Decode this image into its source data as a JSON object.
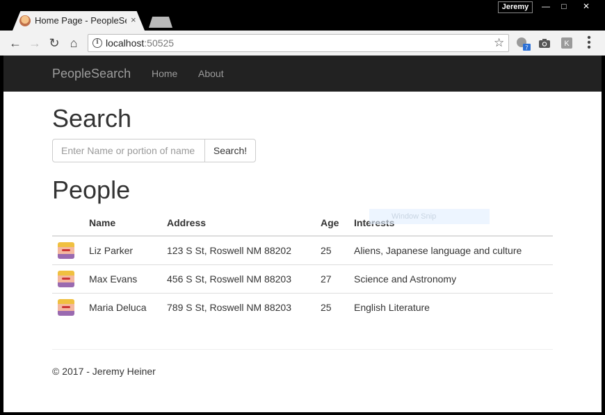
{
  "browser": {
    "tab_title": "Home Page - PeopleSearch",
    "tab_close": "×",
    "profile_name": "Jeremy",
    "url_host": "localhost",
    "url_port": ":50525",
    "ext_badge": "7",
    "ext_k": "K"
  },
  "navbar": {
    "brand": "PeopleSearch",
    "links": [
      "Home",
      "About"
    ]
  },
  "search": {
    "heading": "Search",
    "placeholder": "Enter Name or portion of name",
    "button_label": "Search!"
  },
  "people": {
    "heading": "People",
    "columns": [
      "",
      "Name",
      "Address",
      "Age",
      "Interests"
    ],
    "rows": [
      {
        "name": "Liz Parker",
        "address": "123 S St, Roswell NM 88202",
        "age": "25",
        "interests": "Aliens, Japanese language and culture"
      },
      {
        "name": "Max Evans",
        "address": "456 S St, Roswell NM 88203",
        "age": "27",
        "interests": "Science and Astronomy"
      },
      {
        "name": "Maria Deluca",
        "address": "789 S St, Roswell NM 88203",
        "age": "25",
        "interests": "English Literature"
      }
    ]
  },
  "overlay": {
    "snip_label": "Window Snip"
  },
  "footer": {
    "text": "© 2017 - Jeremy Heiner"
  }
}
